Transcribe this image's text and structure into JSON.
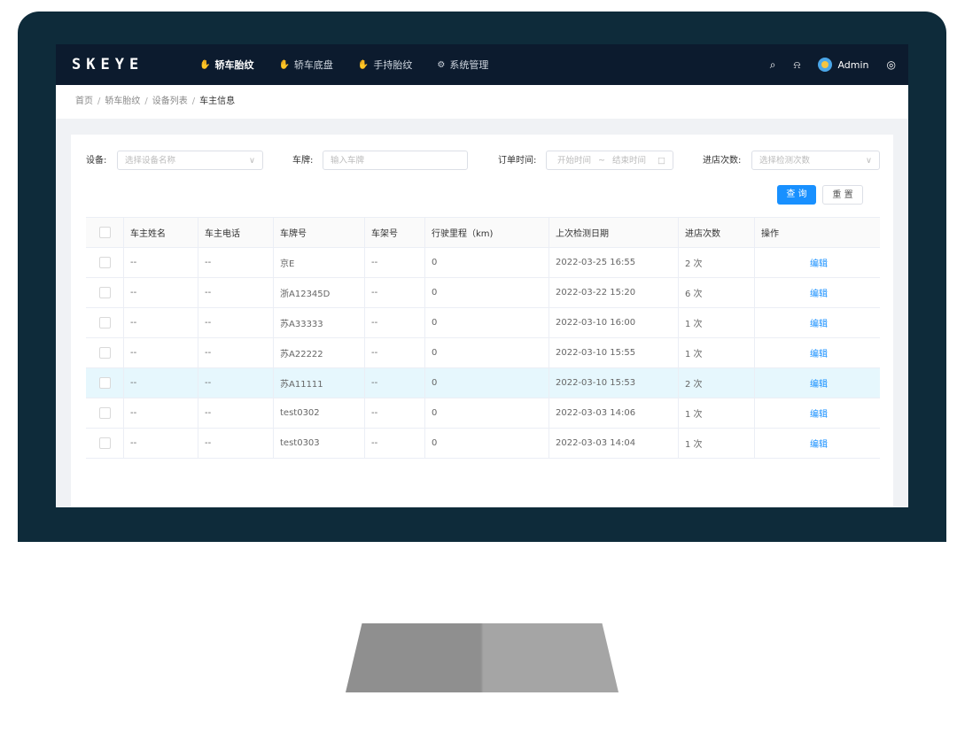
{
  "nav": {
    "logo": "SKEYE",
    "items": [
      {
        "label": "轿车胎纹",
        "icon": "thumb-icon",
        "active": true
      },
      {
        "label": "轿车底盘",
        "icon": "thumb-icon",
        "active": false
      },
      {
        "label": "手持胎纹",
        "icon": "thumb-icon",
        "active": false
      },
      {
        "label": "系统管理",
        "icon": "gear-icon",
        "active": false
      }
    ],
    "user": "Admin"
  },
  "breadcrumb": [
    "首页",
    "轿车胎纹",
    "设备列表",
    "车主信息"
  ],
  "filters": {
    "device_label": "设备:",
    "device_placeholder": "选择设备名称",
    "plate_label": "车牌:",
    "plate_placeholder": "输入车牌",
    "order_time_label": "订单时间:",
    "start_placeholder": "开始时间",
    "range_sep": "~",
    "end_placeholder": "结束时间",
    "visits_label": "进店次数:",
    "visits_placeholder": "选择检测次数",
    "query_button": "查 询",
    "reset_button": "重 置"
  },
  "table": {
    "headers": [
      "车主姓名",
      "车主电话",
      "车牌号",
      "车架号",
      "行驶里程（km)",
      "上次检测日期",
      "进店次数",
      "操作"
    ],
    "rows": [
      {
        "name": "--",
        "phone": "--",
        "plate": "京E",
        "vin": "--",
        "mileage": "0",
        "date": "2022-03-25 16:55",
        "visits": "2 次",
        "action": "编辑"
      },
      {
        "name": "--",
        "phone": "--",
        "plate": "浙A12345D",
        "vin": "--",
        "mileage": "0",
        "date": "2022-03-22 15:20",
        "visits": "6 次",
        "action": "编辑"
      },
      {
        "name": "--",
        "phone": "--",
        "plate": "苏A33333",
        "vin": "--",
        "mileage": "0",
        "date": "2022-03-10 16:00",
        "visits": "1 次",
        "action": "编辑"
      },
      {
        "name": "--",
        "phone": "--",
        "plate": "苏A22222",
        "vin": "--",
        "mileage": "0",
        "date": "2022-03-10 15:55",
        "visits": "1 次",
        "action": "编辑"
      },
      {
        "name": "--",
        "phone": "--",
        "plate": "苏A11111",
        "vin": "--",
        "mileage": "0",
        "date": "2022-03-10 15:53",
        "visits": "2 次",
        "action": "编辑"
      },
      {
        "name": "--",
        "phone": "--",
        "plate": "test0302",
        "vin": "--",
        "mileage": "0",
        "date": "2022-03-03 14:06",
        "visits": "1 次",
        "action": "编辑"
      },
      {
        "name": "--",
        "phone": "--",
        "plate": "test0303",
        "vin": "--",
        "mileage": "0",
        "date": "2022-03-03 14:04",
        "visits": "1 次",
        "action": "编辑"
      }
    ]
  }
}
